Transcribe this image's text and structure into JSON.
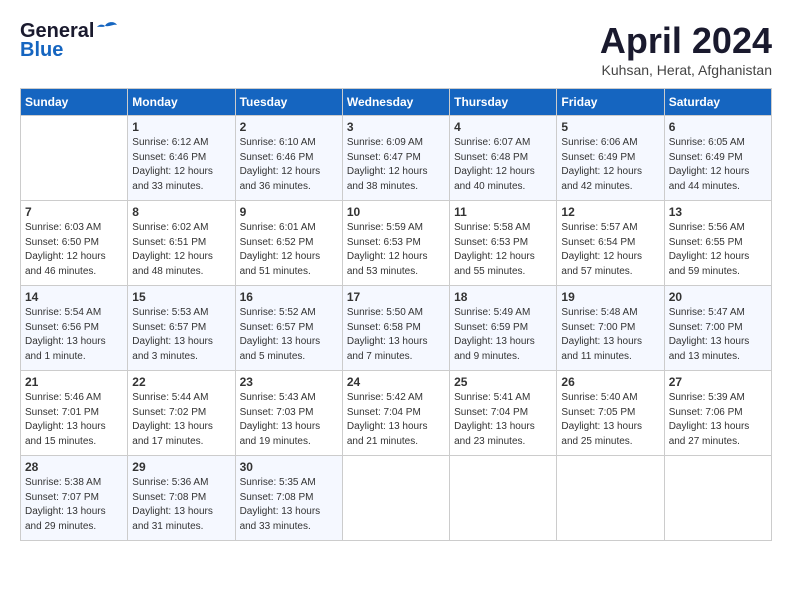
{
  "header": {
    "logo_general": "General",
    "logo_blue": "Blue",
    "month_title": "April 2024",
    "location": "Kuhsan, Herat, Afghanistan"
  },
  "days_of_week": [
    "Sunday",
    "Monday",
    "Tuesday",
    "Wednesday",
    "Thursday",
    "Friday",
    "Saturday"
  ],
  "weeks": [
    [
      {
        "num": "",
        "info": ""
      },
      {
        "num": "1",
        "info": "Sunrise: 6:12 AM\nSunset: 6:46 PM\nDaylight: 12 hours\nand 33 minutes."
      },
      {
        "num": "2",
        "info": "Sunrise: 6:10 AM\nSunset: 6:46 PM\nDaylight: 12 hours\nand 36 minutes."
      },
      {
        "num": "3",
        "info": "Sunrise: 6:09 AM\nSunset: 6:47 PM\nDaylight: 12 hours\nand 38 minutes."
      },
      {
        "num": "4",
        "info": "Sunrise: 6:07 AM\nSunset: 6:48 PM\nDaylight: 12 hours\nand 40 minutes."
      },
      {
        "num": "5",
        "info": "Sunrise: 6:06 AM\nSunset: 6:49 PM\nDaylight: 12 hours\nand 42 minutes."
      },
      {
        "num": "6",
        "info": "Sunrise: 6:05 AM\nSunset: 6:49 PM\nDaylight: 12 hours\nand 44 minutes."
      }
    ],
    [
      {
        "num": "7",
        "info": "Sunrise: 6:03 AM\nSunset: 6:50 PM\nDaylight: 12 hours\nand 46 minutes."
      },
      {
        "num": "8",
        "info": "Sunrise: 6:02 AM\nSunset: 6:51 PM\nDaylight: 12 hours\nand 48 minutes."
      },
      {
        "num": "9",
        "info": "Sunrise: 6:01 AM\nSunset: 6:52 PM\nDaylight: 12 hours\nand 51 minutes."
      },
      {
        "num": "10",
        "info": "Sunrise: 5:59 AM\nSunset: 6:53 PM\nDaylight: 12 hours\nand 53 minutes."
      },
      {
        "num": "11",
        "info": "Sunrise: 5:58 AM\nSunset: 6:53 PM\nDaylight: 12 hours\nand 55 minutes."
      },
      {
        "num": "12",
        "info": "Sunrise: 5:57 AM\nSunset: 6:54 PM\nDaylight: 12 hours\nand 57 minutes."
      },
      {
        "num": "13",
        "info": "Sunrise: 5:56 AM\nSunset: 6:55 PM\nDaylight: 12 hours\nand 59 minutes."
      }
    ],
    [
      {
        "num": "14",
        "info": "Sunrise: 5:54 AM\nSunset: 6:56 PM\nDaylight: 13 hours\nand 1 minute."
      },
      {
        "num": "15",
        "info": "Sunrise: 5:53 AM\nSunset: 6:57 PM\nDaylight: 13 hours\nand 3 minutes."
      },
      {
        "num": "16",
        "info": "Sunrise: 5:52 AM\nSunset: 6:57 PM\nDaylight: 13 hours\nand 5 minutes."
      },
      {
        "num": "17",
        "info": "Sunrise: 5:50 AM\nSunset: 6:58 PM\nDaylight: 13 hours\nand 7 minutes."
      },
      {
        "num": "18",
        "info": "Sunrise: 5:49 AM\nSunset: 6:59 PM\nDaylight: 13 hours\nand 9 minutes."
      },
      {
        "num": "19",
        "info": "Sunrise: 5:48 AM\nSunset: 7:00 PM\nDaylight: 13 hours\nand 11 minutes."
      },
      {
        "num": "20",
        "info": "Sunrise: 5:47 AM\nSunset: 7:00 PM\nDaylight: 13 hours\nand 13 minutes."
      }
    ],
    [
      {
        "num": "21",
        "info": "Sunrise: 5:46 AM\nSunset: 7:01 PM\nDaylight: 13 hours\nand 15 minutes."
      },
      {
        "num": "22",
        "info": "Sunrise: 5:44 AM\nSunset: 7:02 PM\nDaylight: 13 hours\nand 17 minutes."
      },
      {
        "num": "23",
        "info": "Sunrise: 5:43 AM\nSunset: 7:03 PM\nDaylight: 13 hours\nand 19 minutes."
      },
      {
        "num": "24",
        "info": "Sunrise: 5:42 AM\nSunset: 7:04 PM\nDaylight: 13 hours\nand 21 minutes."
      },
      {
        "num": "25",
        "info": "Sunrise: 5:41 AM\nSunset: 7:04 PM\nDaylight: 13 hours\nand 23 minutes."
      },
      {
        "num": "26",
        "info": "Sunrise: 5:40 AM\nSunset: 7:05 PM\nDaylight: 13 hours\nand 25 minutes."
      },
      {
        "num": "27",
        "info": "Sunrise: 5:39 AM\nSunset: 7:06 PM\nDaylight: 13 hours\nand 27 minutes."
      }
    ],
    [
      {
        "num": "28",
        "info": "Sunrise: 5:38 AM\nSunset: 7:07 PM\nDaylight: 13 hours\nand 29 minutes."
      },
      {
        "num": "29",
        "info": "Sunrise: 5:36 AM\nSunset: 7:08 PM\nDaylight: 13 hours\nand 31 minutes."
      },
      {
        "num": "30",
        "info": "Sunrise: 5:35 AM\nSunset: 7:08 PM\nDaylight: 13 hours\nand 33 minutes."
      },
      {
        "num": "",
        "info": ""
      },
      {
        "num": "",
        "info": ""
      },
      {
        "num": "",
        "info": ""
      },
      {
        "num": "",
        "info": ""
      }
    ]
  ]
}
